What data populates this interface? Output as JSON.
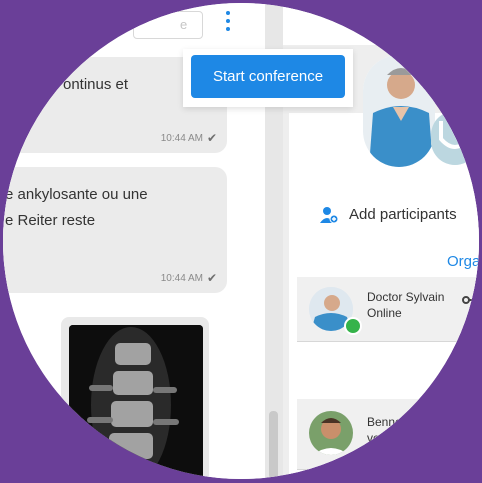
{
  "topbar": {
    "search_placeholder": "e",
    "menu_icon": "kebab-vertical-icon"
  },
  "messages": [
    {
      "text": "ontinus et",
      "time": "10:44 AM",
      "status_icon": "check-icon"
    },
    {
      "text_line1": "e ankylosante ou une",
      "text_line2": "e Reiter reste",
      "time": "10:44 AM",
      "status_icon": "check-icon"
    }
  ],
  "attachment": {
    "type": "xray-image"
  },
  "conference": {
    "start_label": "Start conference"
  },
  "sidebar": {
    "add_participants_label": "Add participants",
    "organizer_label": "Orga",
    "participants": [
      {
        "name": "Doctor Sylvain",
        "status": "Online",
        "online": true
      },
      {
        "name": "Benner",
        "status": "vert",
        "online": false
      }
    ]
  },
  "colors": {
    "background": "#6a3f98",
    "accent": "#1e88e5",
    "online": "#35b34a"
  }
}
